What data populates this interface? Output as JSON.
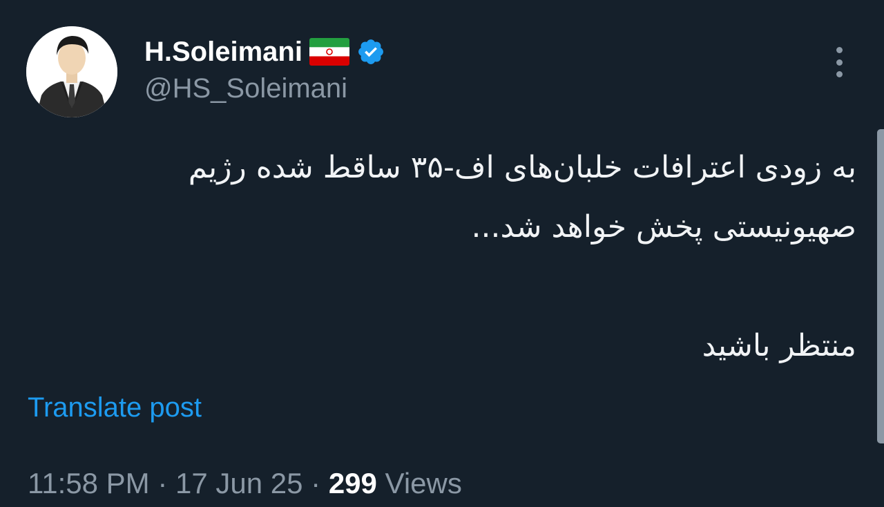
{
  "author": {
    "display_name": "H.Soleimani",
    "handle": "@HS_Soleimani",
    "flag_icon": "iran-flag-icon",
    "verified_icon": "verified-badge-icon",
    "verified_color": "#1d9bf0"
  },
  "tweet": {
    "lines": [
      "به زودی اعترافات خلبان‌های اف-۳۵ ساقط شده رژیم",
      "صهیونیستی پخش خواهد شد...",
      "منتظر باشید"
    ]
  },
  "translate": {
    "label": "Translate post"
  },
  "meta": {
    "time": "11:58 PM",
    "separator1": " · ",
    "date": "17 Jun 25",
    "separator2": " · ",
    "views_count": "299",
    "views_label": " Views"
  },
  "more_icon": "more-vertical-icon",
  "colors": {
    "background": "#15202b",
    "link": "#1d9bf0",
    "secondary_text": "#8b98a5"
  }
}
